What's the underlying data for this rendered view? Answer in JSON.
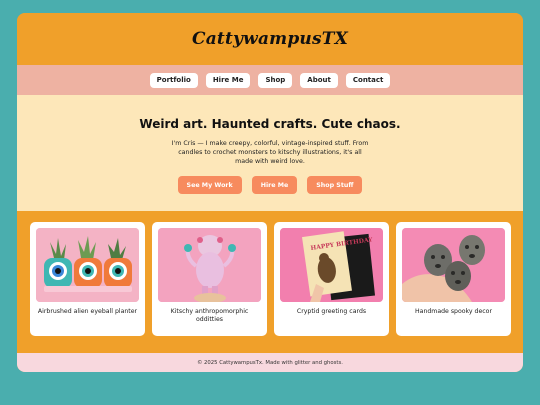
{
  "site": {
    "title": "CattywampusTX"
  },
  "nav": {
    "items": [
      "Portfolio",
      "Hire Me",
      "Shop",
      "About",
      "Contact"
    ]
  },
  "hero": {
    "heading": "Weird art. Haunted crafts. Cute chaos.",
    "text": "I'm Cris — I make creepy, colorful, vintage-inspired stuff. From candles to crochet monsters to kitschy illustrations, it's all made with weird love.",
    "buttons": [
      "See My Work",
      "Hire Me",
      "Shop Stuff"
    ]
  },
  "gallery": {
    "items": [
      {
        "caption": "Airbrushed alien eyeball planter",
        "icon": "eyeball-planter-photo"
      },
      {
        "caption": "Kitschy anthropomorphic odditties",
        "icon": "anthropomorphic-figurine-photo"
      },
      {
        "caption": "Cryptid greeting cards",
        "icon": "greeting-card-photo",
        "card_text": "HAPPY BIRTHDAY"
      },
      {
        "caption": "Handmade spooky decor",
        "icon": "doll-heads-photo"
      }
    ]
  },
  "footer": {
    "text": "© 2025 CattywampusTx. Made with glitter and ghosts."
  },
  "colors": {
    "background": "#4aaeae",
    "header": "#f0a02a",
    "nav": "#eeb2a2",
    "hero": "#fde7b9",
    "cta": "#f78b5e",
    "footer": "#f8d8de"
  }
}
